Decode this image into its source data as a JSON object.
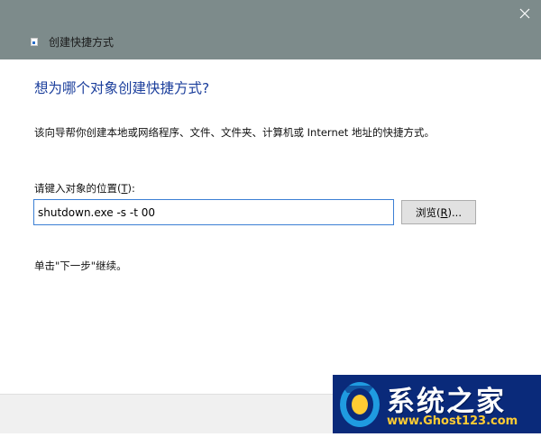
{
  "window": {
    "title": "创建快捷方式",
    "close_label": "Close"
  },
  "wizard": {
    "heading": "想为哪个对象创建快捷方式?",
    "description": "该向导帮你创建本地或网络程序、文件、文件夹、计算机或 Internet 地址的快捷方式。",
    "location_label_pre": "请键入对象的位置(",
    "location_label_key": "T",
    "location_label_post": "):",
    "location_value": "shutdown.exe -s -t 00",
    "browse_pre": "浏览(",
    "browse_key": "R",
    "browse_post": ")...",
    "continue_hint": "单击\"下一步\"继续。"
  },
  "watermark": {
    "title": "系统之家",
    "url": "www.Ghost123.com"
  },
  "colors": {
    "titlebar": "#7d8b8b",
    "heading": "#1c3f9c",
    "input_border": "#3c7fd4",
    "footer": "#f0f0f0",
    "watermark_bg": "#0a2a7a",
    "watermark_url": "#ffcc33"
  },
  "icons": {
    "window_icon": "shortcut-icon",
    "close_icon": "close-icon",
    "logo": "ghost-logo"
  }
}
